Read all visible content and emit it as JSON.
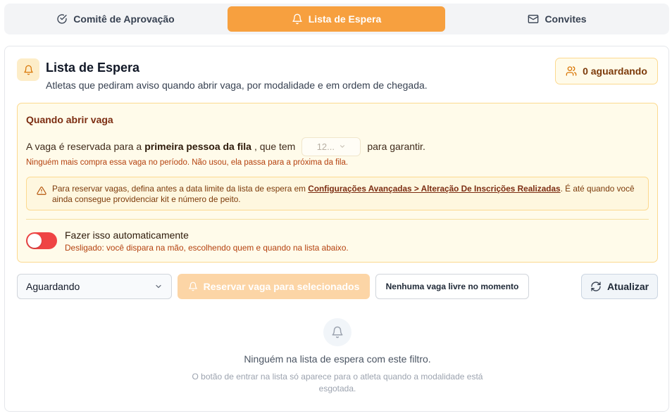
{
  "tabs": [
    {
      "label": "Comitê de Aprovação",
      "icon": "check-circle-icon",
      "active": false
    },
    {
      "label": "Lista de Espera",
      "icon": "bell-icon",
      "active": true
    },
    {
      "label": "Convites",
      "icon": "mail-icon",
      "active": false
    }
  ],
  "header": {
    "title": "Lista de Espera",
    "subtitle": "Atletas que pediram aviso quando abrir vaga, por modalidade e em ordem de chegada.",
    "badge": "0 aguardando"
  },
  "info": {
    "title": "Quando abrir vaga",
    "line_prefix": "A vaga é reservada para a",
    "line_bold": "primeira pessoa da fila",
    "line_middle": ", que tem",
    "hours_value": "12...",
    "line_suffix": "para garantir.",
    "note": "Ninguém mais compra essa vaga no período. Não usou, ela passa para a próxima da fila.",
    "warning_prefix": "Para reservar vagas, defina antes a data limite da lista de espera em",
    "warning_link": "Configurações Avançadas > Alteração De Inscrições Realizadas",
    "warning_suffix": ". É até quando você ainda consegue providenciar kit e número de peito.",
    "toggle_label": "Fazer isso automaticamente",
    "toggle_sub": "Desligado: você dispara na mão, escolhendo quem e quando na lista abaixo.",
    "toggle_on": false
  },
  "controls": {
    "filter_value": "Aguardando",
    "reserve_label": "Reservar vaga para selecionados",
    "no_vacancy_label": "Nenhuma vaga livre no momento",
    "refresh_label": "Atualizar"
  },
  "empty": {
    "title": "Ninguém na lista de espera com este filtro.",
    "subtitle": "O botão de entrar na lista só aparece para o atleta quando a modalidade está esgotada."
  },
  "colors": {
    "accent": "#f7a03f",
    "warning_bg": "#fffbea",
    "warning_border": "#fcd98f",
    "toggle_off": "#ef4444"
  }
}
